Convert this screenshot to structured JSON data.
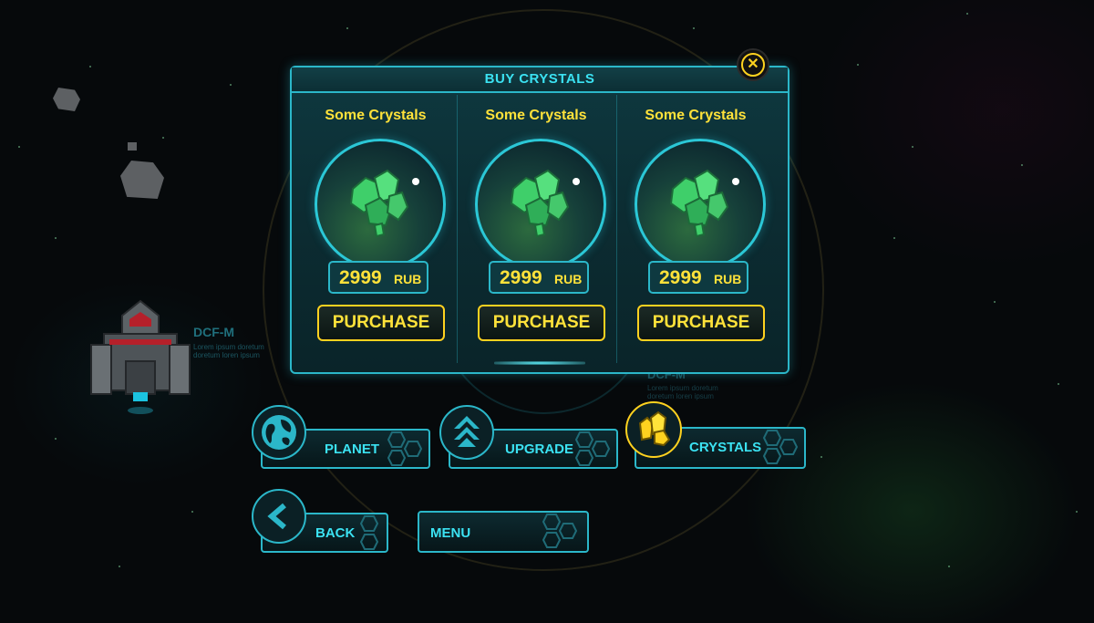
{
  "panel": {
    "title": "BUY CRYSTALS",
    "close_icon": "close-icon",
    "offers": [
      {
        "name": "Some Crystals",
        "price": "2999",
        "currency": "RUB",
        "button": "PURCHASE",
        "icon": "crystal-icon"
      },
      {
        "name": "Some Crystals",
        "price": "2999",
        "currency": "RUB",
        "button": "PURCHASE",
        "icon": "crystal-icon"
      },
      {
        "name": "Some Crystals",
        "price": "2999",
        "currency": "RUB",
        "button": "PURCHASE",
        "icon": "crystal-icon"
      }
    ]
  },
  "ship": {
    "name": "DCF-M",
    "description": "Lorem ipsum doretum doretum loren ipsum"
  },
  "ghost_ship": {
    "name": "DCF-M",
    "description": "Lorem ipsum doretum doretum loren ipsum"
  },
  "nav": {
    "planet": {
      "label": "PLANET",
      "icon": "planet-icon"
    },
    "upgrade": {
      "label": "UPGRADE",
      "icon": "upgrade-arrows-icon"
    },
    "crystals": {
      "label": "CRYSTALS",
      "icon": "crystals-icon",
      "active": true
    },
    "back": {
      "label": "BACK",
      "icon": "back-arrow-icon"
    },
    "menu": {
      "label": "MENU"
    }
  },
  "colors": {
    "accent": "#2bb7c9",
    "title_text": "#3be2f2",
    "highlight": "#ffd21f",
    "crystal_green": "#3fcf6a",
    "background": "#06090b"
  }
}
